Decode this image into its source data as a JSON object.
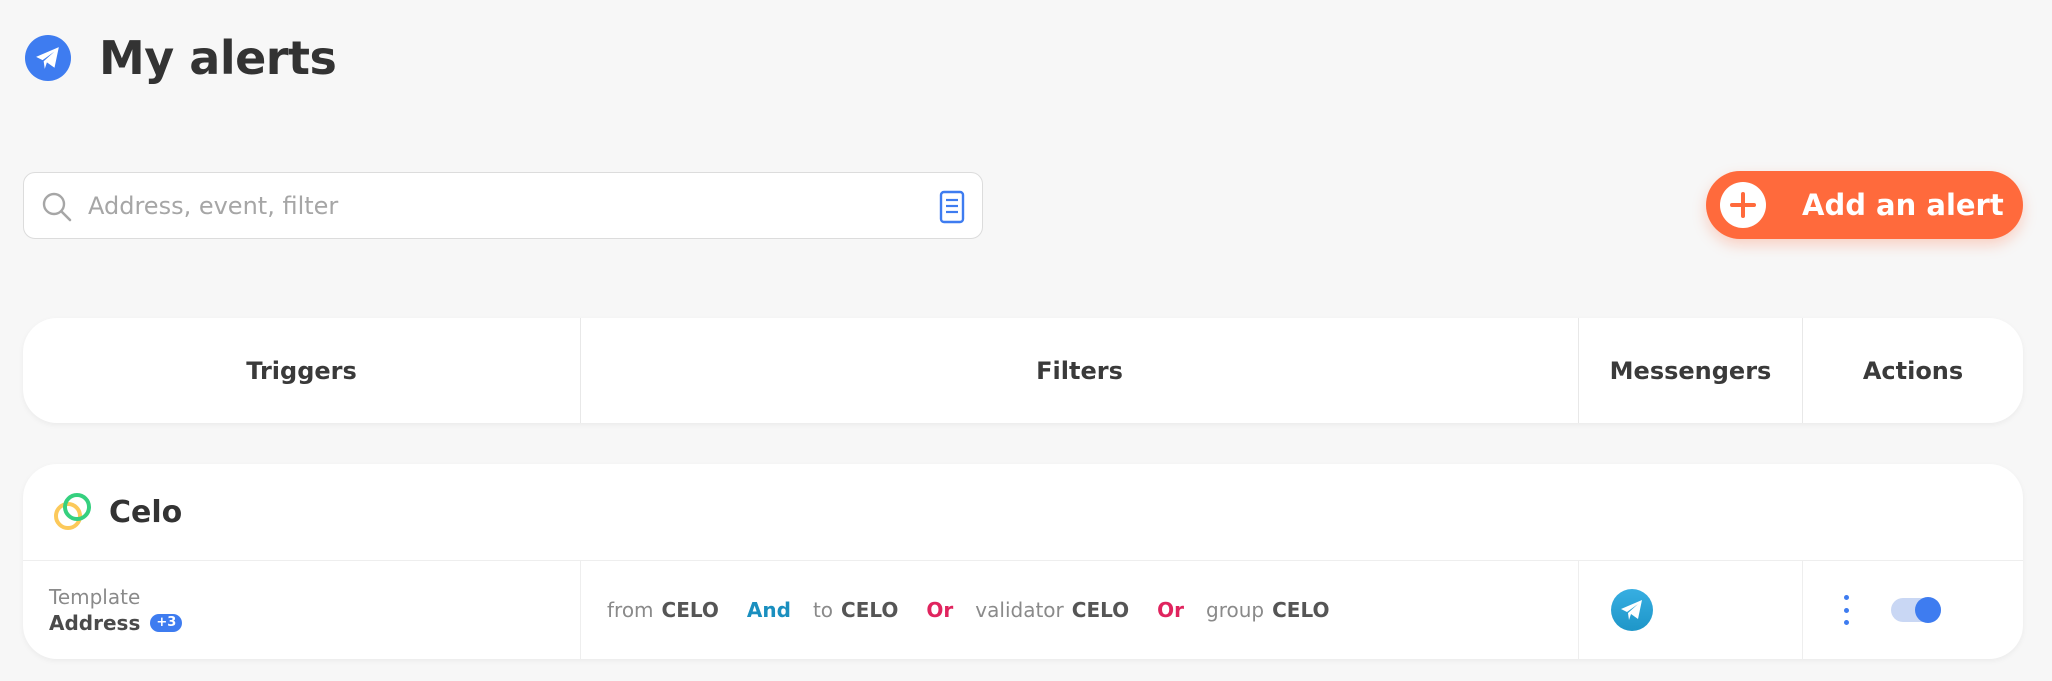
{
  "header": {
    "title": "My alerts",
    "logo_icon": "paper-plane-icon",
    "accent": "#3e7cf0"
  },
  "search": {
    "placeholder": "Address, event, filter",
    "value": ""
  },
  "add_button": {
    "label": "Add an alert",
    "color": "#ff6a3c"
  },
  "table": {
    "columns": [
      "Triggers",
      "Filters",
      "Messengers",
      "Actions"
    ]
  },
  "alerts": [
    {
      "chain": "Celo",
      "trigger_type": "Template",
      "trigger_name": "Address",
      "trigger_extra": "+3",
      "filters": [
        {
          "key": "from",
          "value": "CELO"
        },
        {
          "op": "And"
        },
        {
          "key": "to",
          "value": "CELO"
        },
        {
          "op": "Or"
        },
        {
          "key": "validator",
          "value": "CELO"
        },
        {
          "op": "Or"
        },
        {
          "key": "group",
          "value": "CELO"
        }
      ],
      "messenger": "telegram-icon",
      "enabled": true
    }
  ]
}
